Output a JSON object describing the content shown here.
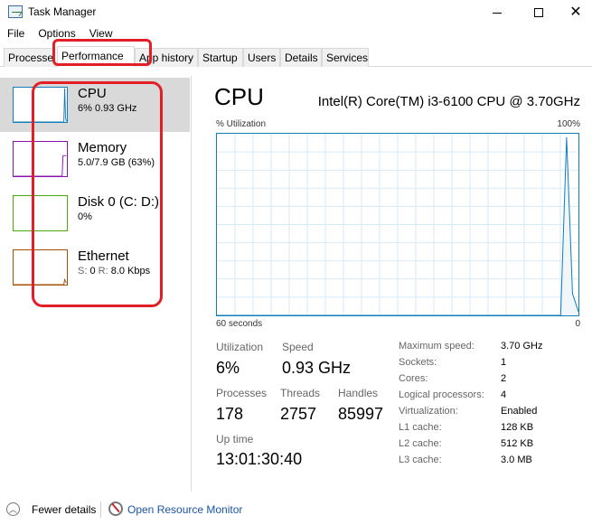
{
  "window": {
    "title": "Task Manager"
  },
  "menu": [
    "File",
    "Options",
    "View"
  ],
  "tabs": [
    {
      "label": "Processes",
      "active": false
    },
    {
      "label": "Performance",
      "active": true
    },
    {
      "label": "App history",
      "active": false
    },
    {
      "label": "Startup",
      "active": false
    },
    {
      "label": "Users",
      "active": false
    },
    {
      "label": "Details",
      "active": false
    },
    {
      "label": "Services",
      "active": false
    }
  ],
  "sidebar": [
    {
      "title": "CPU",
      "subtitle": "6% 0.93 GHz",
      "color": "#117dbb",
      "selected": true
    },
    {
      "title": "Memory",
      "subtitle": "5.0/7.9 GB (63%)",
      "color": "#8b12ae",
      "selected": false
    },
    {
      "title": "Disk 0 (C: D:)",
      "subtitle": "0%",
      "color": "#4da60c",
      "selected": false
    },
    {
      "title": "Ethernet",
      "subtitle_label_s": "S:",
      "subtitle_val_s": "0",
      "subtitle_label_r": "R:",
      "subtitle_val_r": "8.0 Kbps",
      "color": "#a74f01",
      "selected": false
    }
  ],
  "main": {
    "title": "CPU",
    "model": "Intel(R) Core(TM) i3-6100 CPU @ 3.70GHz",
    "graph": {
      "y_label": "% Utilization",
      "y_max_label": "100%",
      "x_left_label": "60 seconds",
      "x_right_label": "0",
      "line_color": "#117dbb",
      "grid_color": "#d9eaf7",
      "fill_color": "#f1f6fa",
      "samples": [
        0,
        0,
        0,
        0,
        0,
        0,
        0,
        0,
        0,
        0,
        0,
        0,
        0,
        0,
        0,
        0,
        0,
        0,
        0,
        0,
        0,
        0,
        0,
        0,
        0,
        0,
        0,
        0,
        0,
        0,
        0,
        0,
        0,
        0,
        0,
        0,
        0,
        0,
        0,
        0,
        0,
        0,
        0,
        0,
        0,
        0,
        0,
        0,
        0,
        0,
        0,
        0,
        0,
        0,
        0,
        0,
        0,
        0,
        0,
        98,
        12,
        2
      ]
    },
    "stats": {
      "utilization": {
        "label": "Utilization",
        "value": "6%"
      },
      "speed": {
        "label": "Speed",
        "value": "0.93 GHz"
      },
      "processes": {
        "label": "Processes",
        "value": "178"
      },
      "threads": {
        "label": "Threads",
        "value": "2757"
      },
      "handles": {
        "label": "Handles",
        "value": "85997"
      },
      "uptime": {
        "label": "Up time",
        "value": "13:01:30:40"
      }
    },
    "details": [
      {
        "label": "Maximum speed:",
        "value": "3.70 GHz"
      },
      {
        "label": "Sockets:",
        "value": "1"
      },
      {
        "label": "Cores:",
        "value": "2"
      },
      {
        "label": "Logical processors:",
        "value": "4"
      },
      {
        "label": "Virtualization:",
        "value": "Enabled"
      },
      {
        "label": "L1 cache:",
        "value": "128 KB"
      },
      {
        "label": "L2 cache:",
        "value": "512 KB"
      },
      {
        "label": "L3 cache:",
        "value": "3.0 MB"
      }
    ]
  },
  "footer": {
    "fewer_details": "Fewer details",
    "open_resource_monitor": "Open Resource Monitor"
  },
  "annotation_color": "#e21e26"
}
